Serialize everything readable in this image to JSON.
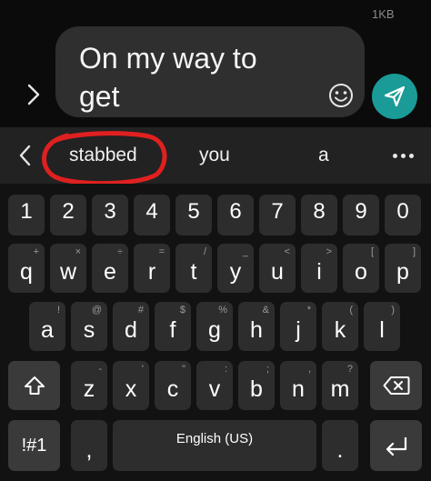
{
  "header": {
    "size_label": "1KB"
  },
  "composer": {
    "message_text": "On my way to\nget"
  },
  "suggestions": [
    "stabbed",
    "you",
    "a"
  ],
  "keyboard": {
    "number_row": [
      "1",
      "2",
      "3",
      "4",
      "5",
      "6",
      "7",
      "8",
      "9",
      "0"
    ],
    "row1": [
      {
        "key": "q",
        "alt": "+"
      },
      {
        "key": "w",
        "alt": "×"
      },
      {
        "key": "e",
        "alt": "÷"
      },
      {
        "key": "r",
        "alt": "="
      },
      {
        "key": "t",
        "alt": "/"
      },
      {
        "key": "y",
        "alt": "_"
      },
      {
        "key": "u",
        "alt": "<"
      },
      {
        "key": "i",
        "alt": ">"
      },
      {
        "key": "o",
        "alt": "["
      },
      {
        "key": "p",
        "alt": "]"
      }
    ],
    "row2": [
      {
        "key": "a",
        "alt": "!"
      },
      {
        "key": "s",
        "alt": "@"
      },
      {
        "key": "d",
        "alt": "#"
      },
      {
        "key": "f",
        "alt": "$"
      },
      {
        "key": "g",
        "alt": "%"
      },
      {
        "key": "h",
        "alt": "&"
      },
      {
        "key": "j",
        "alt": "*"
      },
      {
        "key": "k",
        "alt": "("
      },
      {
        "key": "l",
        "alt": ")"
      }
    ],
    "row3": [
      {
        "key": "z",
        "alt": "-"
      },
      {
        "key": "x",
        "alt": "'"
      },
      {
        "key": "c",
        "alt": "\""
      },
      {
        "key": "v",
        "alt": ":"
      },
      {
        "key": "b",
        "alt": ";"
      },
      {
        "key": "n",
        "alt": ","
      },
      {
        "key": "m",
        "alt": "?"
      }
    ],
    "symbols_label": "!#1",
    "comma_label": ",",
    "space_label": "English (US)",
    "period_label": "."
  },
  "colors": {
    "send_button": "#1a9b97",
    "annotation_circle": "#e02020"
  },
  "icons": [
    "chevron-right-icon",
    "emoji-icon",
    "send-icon",
    "chevron-left-icon",
    "more-icon",
    "shift-icon",
    "backspace-icon",
    "enter-icon"
  ]
}
